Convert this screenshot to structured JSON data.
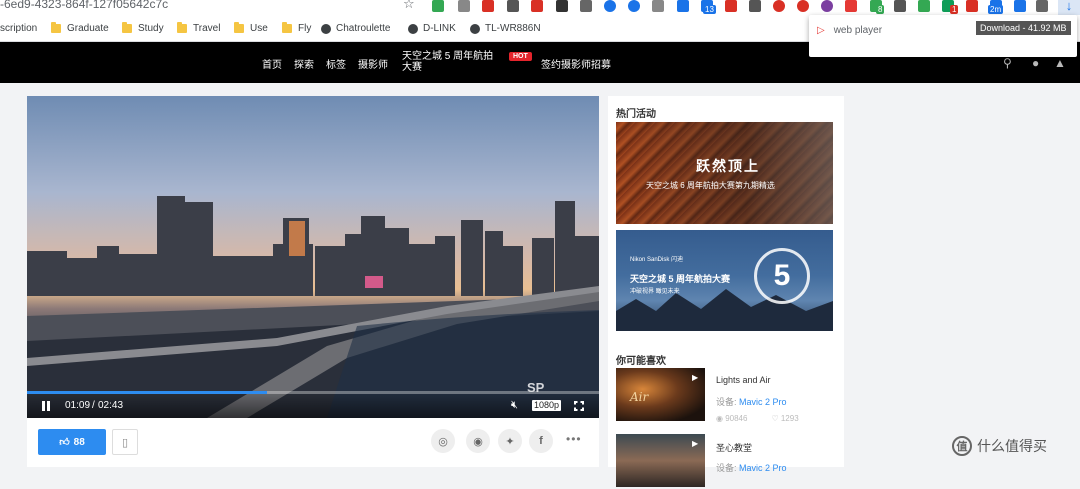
{
  "browser": {
    "url_fragment": "-6ed9-4323-864f-127f05642c7c",
    "ext_badges": [
      "8",
      "13",
      "1",
      "2m"
    ],
    "bookmarks": [
      {
        "label": "scription",
        "icon": "none"
      },
      {
        "label": "Graduate",
        "icon": "folder-icon"
      },
      {
        "label": "Study",
        "icon": "folder-icon"
      },
      {
        "label": "Travel",
        "icon": "folder-icon"
      },
      {
        "label": "Use",
        "icon": "folder-icon"
      },
      {
        "label": "Fly",
        "icon": "folder-icon"
      },
      {
        "label": "Chatroulette",
        "icon": "globe-icon"
      },
      {
        "label": "D-LINK",
        "icon": "globe-icon"
      },
      {
        "label": "TL-WR886N",
        "icon": "globe-icon"
      }
    ],
    "download": {
      "tooltip": "Download - 41.92 MB",
      "item_label": "web player"
    }
  },
  "site_nav": {
    "items": [
      "首页",
      "探索",
      "标签",
      "摄影师"
    ],
    "contest": "天空之城 5 周年航拍大赛",
    "hot": "HOT",
    "signup": "签约摄影师招募"
  },
  "video": {
    "current_time": "01:09",
    "duration": "02:43",
    "progress_fraction": 0.42,
    "quality": "1080p",
    "watermark": "SP"
  },
  "actions": {
    "like_count": "88",
    "share_icons": [
      "wechat-icon",
      "weibo-icon",
      "twitter-icon",
      "facebook-icon"
    ]
  },
  "sidebar": {
    "hot_title": "热门活动",
    "banner1_main": "跃然顶上",
    "banner1_sub": "天空之城 6 周年航拍大赛第九期精选",
    "banner2_sponsor": "Nikon SanDisk 闪迪",
    "banner2_main": "天空之城 5 周年航拍大赛",
    "banner2_sub": "冲破视界 瞰见未来",
    "banner2_number": "5",
    "rec_title": "你可能喜欢",
    "recs": [
      {
        "title": "Lights and Air",
        "device_label": "设备: ",
        "device": "Mavic 2 Pro",
        "views": "90846",
        "likes": "1293",
        "thumb_text": "Air"
      },
      {
        "title": "圣心教堂",
        "device_label": "设备: ",
        "device": "Mavic 2 Pro",
        "views": "",
        "likes": "",
        "thumb_text": ""
      }
    ]
  },
  "brand": {
    "logo": "值",
    "text": "什么值得买"
  },
  "colors": {
    "accent": "#2d8cf0",
    "hot": "#e5242c",
    "nav_bg": "#000000"
  }
}
